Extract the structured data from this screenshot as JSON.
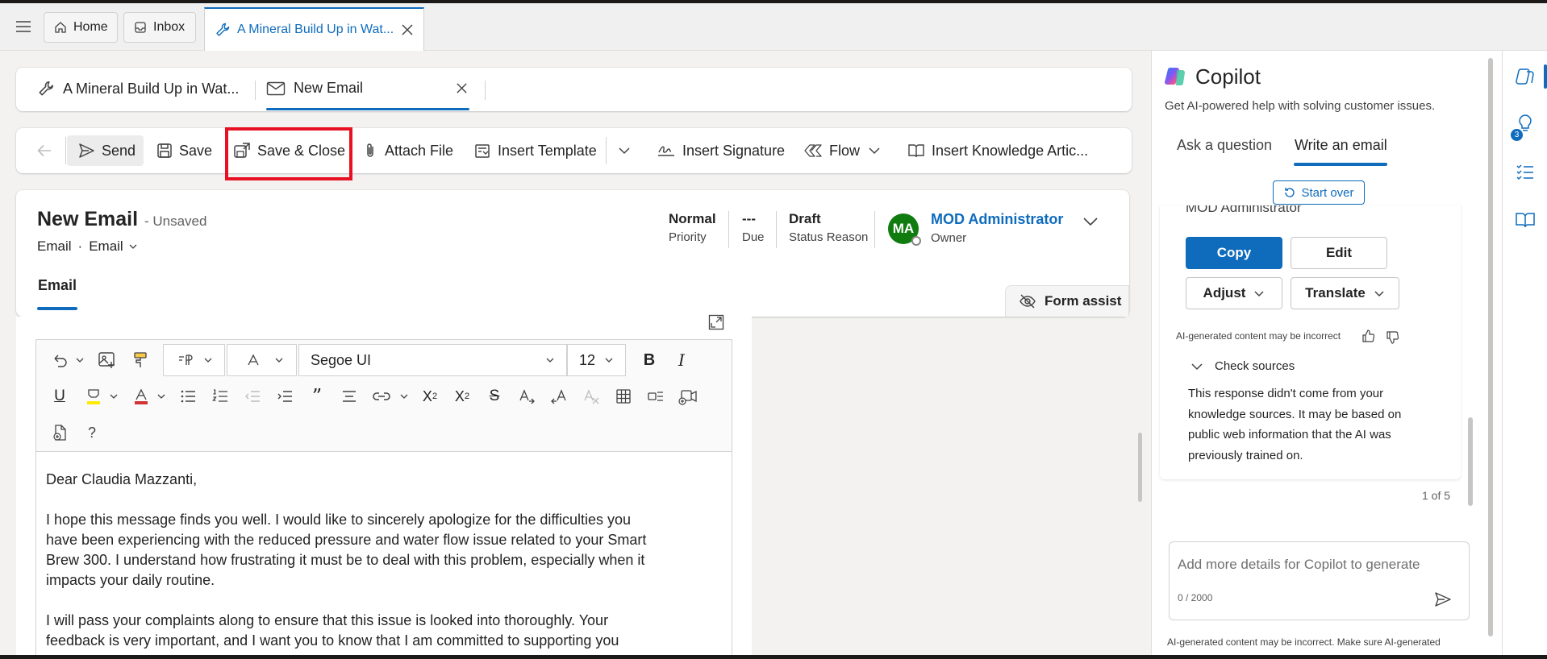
{
  "tabs": {
    "home": "Home",
    "inbox": "Inbox",
    "active": "A Mineral Build Up in Wat..."
  },
  "record_tabs": {
    "case": "A Mineral Build Up in Wat...",
    "email": "New Email"
  },
  "toolbar": {
    "send": "Send",
    "save": "Save",
    "save_close": "Save & Close",
    "attach": "Attach File",
    "insert_template": "Insert Template",
    "insert_signature": "Insert Signature",
    "flow": "Flow",
    "insert_knowledge": "Insert Knowledge Artic..."
  },
  "header": {
    "title": "New Email",
    "unsaved": "- Unsaved",
    "entity": "Email",
    "form": "Email",
    "priority_value": "Normal",
    "priority_label": "Priority",
    "due_value": "---",
    "due_label": "Due",
    "status_value": "Draft",
    "status_label": "Status Reason",
    "owner_initials": "MA",
    "owner_name": "MOD Administrator",
    "owner_label": "Owner",
    "tab_email": "Email",
    "form_assist": "Form assist"
  },
  "editor": {
    "font": "Segoe UI",
    "size": "12",
    "help": "?"
  },
  "email_body": {
    "greeting": "Dear Claudia Mazzanti,",
    "p1_l1": "I hope this message finds you well. I would like to sincerely apologize for the difficulties you",
    "p1_l2": "have been experiencing with the reduced pressure and water flow issue related to your Smart",
    "p1_l3": "Brew 300. I understand how frustrating it must be to deal with this problem, especially when it",
    "p1_l4": "impacts your daily routine.",
    "p2_l1": "I will pass your complaints along to ensure that this issue is looked into thoroughly. Your",
    "p2_l2": "feedback is very important, and I want you to know that I am committed to supporting you"
  },
  "copilot": {
    "title": "Copilot",
    "subtitle": "Get AI-powered help with solving customer issues.",
    "tab_ask": "Ask a question",
    "tab_write": "Write an email",
    "start_over": "Start over",
    "signature": "MOD Administrator",
    "copy": "Copy",
    "edit": "Edit",
    "adjust": "Adjust",
    "translate": "Translate",
    "ai_notice": "AI-generated content may be incorrect",
    "check_sources": "Check sources",
    "source_l1": "This response didn't come from your",
    "source_l2": "knowledge sources. It may be based on",
    "source_l3": "public web information that the AI was",
    "source_l4": "previously trained on.",
    "pager": "1 of 5",
    "input_placeholder": "Add more details for Copilot to generate",
    "char_count": "0 / 2000",
    "footer_notice": "AI-generated content may be incorrect. Make sure AI-generated"
  },
  "rail": {
    "badge": "3"
  },
  "colors": {
    "accent": "#0f6cbd",
    "highlight": "#e81123",
    "avatar": "#107c10"
  }
}
